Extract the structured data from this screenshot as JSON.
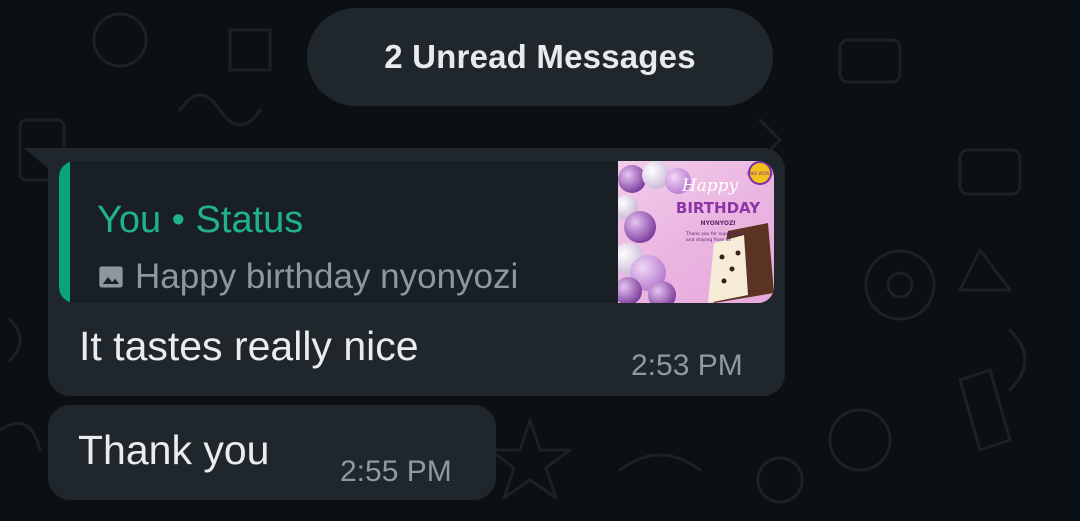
{
  "banner": {
    "unread_label": "2 Unread Messages"
  },
  "messages": [
    {
      "quote": {
        "author": "You • Status",
        "icon": "image-icon",
        "text": "Happy birthday nyonyozi",
        "thumbnail": {
          "happy": "Happy",
          "title": "BIRTHDAY",
          "subtitle": "NYONYOZI",
          "caption_1": "Thank you for supporting",
          "caption_2": "and staying from us",
          "badge": "CAKE WORLD"
        }
      },
      "text": "It tastes really nice",
      "time": "2:53 PM"
    },
    {
      "text": "Thank you",
      "time": "2:55 PM"
    }
  ],
  "colors": {
    "background": "#0b1014",
    "bubble": "#1f272d",
    "quote_bg": "#182025",
    "quote_accent": "#06a57c",
    "author_green": "#21b28a"
  }
}
